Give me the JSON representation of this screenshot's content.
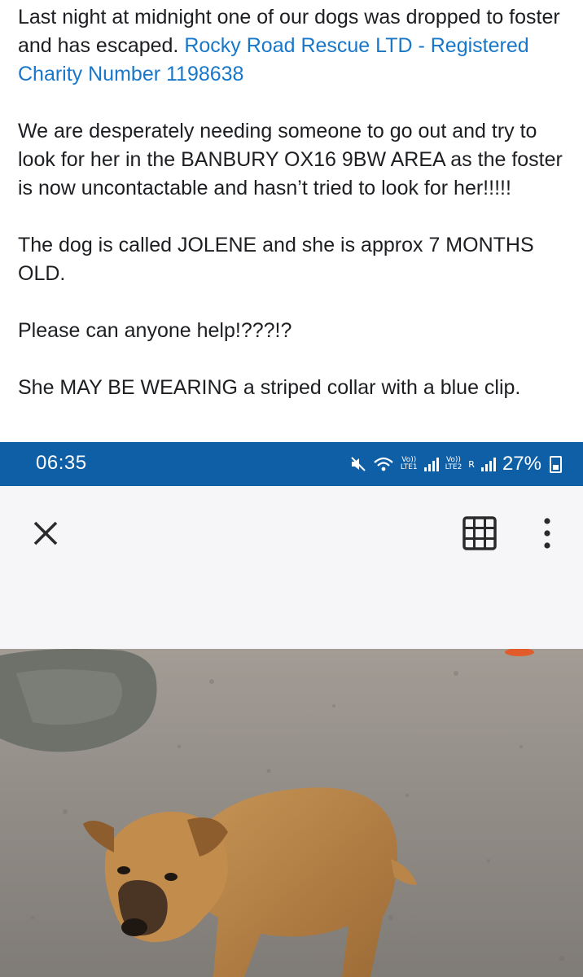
{
  "post": {
    "para1_text": "Last night at midnight one of our dogs was dropped to foster and has escaped. ",
    "para1_link": "Rocky Road Rescue LTD - Registered Charity Number 1198638",
    "para2": "We are desperately needing someone to go out and try to look for her in the BANBURY OX16 9BW AREA as the foster is now uncontactable and hasn’t tried to look for her!!!!!",
    "para3": "The dog is called JOLENE and she is approx 7 MONTHS OLD.",
    "para4": "Please can anyone help!???!?",
    "para5": "She MAY BE WEARING a striped collar with a blue clip.",
    "link_color": "#1877c9"
  },
  "status_bar": {
    "time": "06:35",
    "sim1_top": "Vo))",
    "sim1_bottom": "LTE1",
    "sim2_top": "Vo))",
    "sim2_bottom": "LTE2",
    "roaming": "R",
    "battery": "27%",
    "background": "#0f5fa6"
  },
  "viewer_toolbar": {
    "icons": [
      "close-icon",
      "grid-icon",
      "more-vertical-icon"
    ]
  }
}
